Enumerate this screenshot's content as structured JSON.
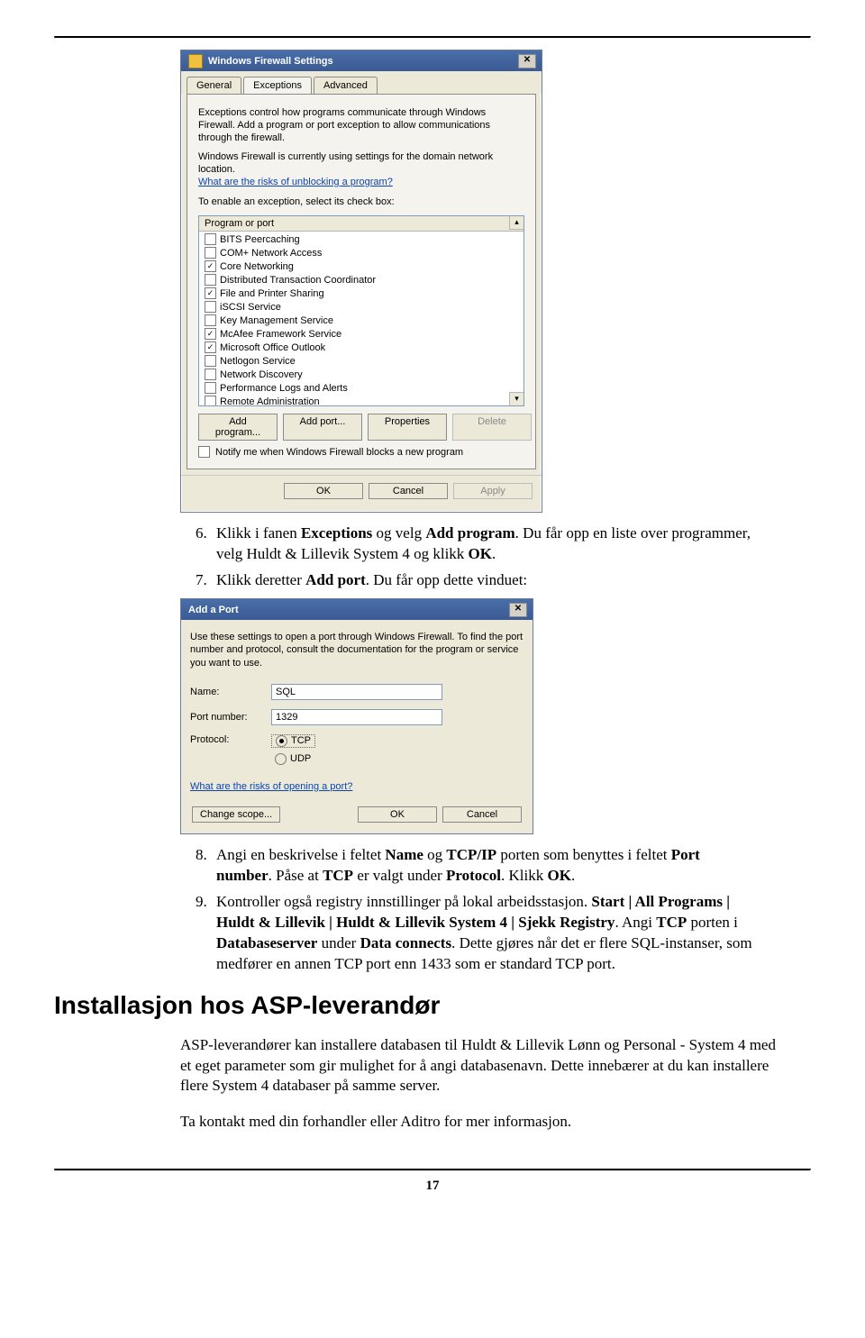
{
  "firewall_dialog": {
    "title": "Windows Firewall Settings",
    "tabs": {
      "general": "General",
      "exceptions": "Exceptions",
      "advanced": "Advanced"
    },
    "intro": "Exceptions control how programs communicate through Windows Firewall. Add a program or port exception to allow communications through the firewall.",
    "domain_notice": "Windows Firewall is currently using settings for the domain network location.",
    "risks_link": "What are the risks of unblocking a program?",
    "enable_text": "To enable an exception, select its check box:",
    "col_header": "Program or port",
    "items": [
      {
        "label": "BITS Peercaching",
        "checked": false
      },
      {
        "label": "COM+ Network Access",
        "checked": false
      },
      {
        "label": "Core Networking",
        "checked": true
      },
      {
        "label": "Distributed Transaction Coordinator",
        "checked": false
      },
      {
        "label": "File and Printer Sharing",
        "checked": true
      },
      {
        "label": "iSCSI Service",
        "checked": false
      },
      {
        "label": "Key Management Service",
        "checked": false
      },
      {
        "label": "McAfee Framework Service",
        "checked": true
      },
      {
        "label": "Microsoft Office Outlook",
        "checked": true
      },
      {
        "label": "Netlogon Service",
        "checked": false
      },
      {
        "label": "Network Discovery",
        "checked": false
      },
      {
        "label": "Performance Logs and Alerts",
        "checked": false
      },
      {
        "label": "Remote Administration",
        "checked": false
      }
    ],
    "buttons": {
      "add_program": "Add program...",
      "add_port": "Add port...",
      "properties": "Properties",
      "delete": "Delete"
    },
    "notify_label": "Notify me when Windows Firewall blocks a new program",
    "ok": "OK",
    "cancel": "Cancel",
    "apply": "Apply"
  },
  "add_port_dialog": {
    "title": "Add a Port",
    "intro": "Use these settings to open a port through Windows Firewall. To find the port number and protocol, consult the documentation for the program or service you want to use.",
    "name_label": "Name:",
    "name_value": "SQL",
    "port_label": "Port number:",
    "port_value": "1329",
    "protocol_label": "Protocol:",
    "tcp": "TCP",
    "udp": "UDP",
    "risks_link": "What are the risks of opening a port?",
    "change_scope": "Change scope...",
    "ok": "OK",
    "cancel": "Cancel"
  },
  "doc": {
    "step6": {
      "num": "6.",
      "pre": "Klikk i fanen ",
      "b1": "Exceptions",
      "mid1": " og velg ",
      "b2": "Add program",
      "mid2": ". Du får opp en liste over programmer, velg Huldt & Lillevik System 4 og klikk ",
      "b3": "OK",
      "end": "."
    },
    "step7": {
      "num": "7.",
      "pre": "Klikk deretter ",
      "b1": "Add port",
      "end": ". Du får opp dette vinduet:"
    },
    "step8": {
      "num": "8.",
      "pre": "Angi en beskrivelse i feltet ",
      "b1": "Name",
      "mid1": " og ",
      "b2": "TCP/IP",
      "mid2": " porten som benyttes i feltet ",
      "b3": "Port number",
      "mid3": ". Påse at ",
      "b4": "TCP",
      "mid4": " er valgt under ",
      "b5": "Protocol",
      "mid5": ". Klikk ",
      "b6": "OK",
      "end": "."
    },
    "step9": {
      "num": "9.",
      "pre": "Kontroller også registry innstillinger på lokal arbeidsstasjon. ",
      "b1": "Start | All Programs | Huldt & Lillevik | Huldt & Lillevik System 4 | Sjekk Registry",
      "mid1": ". Angi ",
      "b2": "TCP",
      "mid2": " porten i ",
      "b3": "Databaseserver",
      "mid3": " under ",
      "b4": "Data connects",
      "end": ". Dette gjøres når det er flere SQL-instanser, som medfører en annen TCP port enn 1433 som er standard TCP port."
    },
    "heading": "Installasjon hos ASP-leverandør",
    "p1": "ASP-leverandører kan installere databasen til Huldt & Lillevik Lønn og Personal - System 4 med et eget parameter som gir mulighet for å angi databasenavn. Dette innebærer at du kan installere flere System 4 databaser på samme server.",
    "p2": "Ta kontakt med din forhandler eller Aditro for mer informasjon.",
    "page_number": "17"
  }
}
